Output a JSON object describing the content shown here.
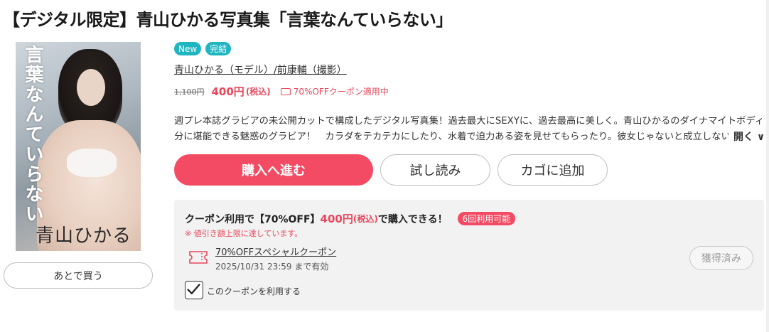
{
  "product": {
    "title": "【デジタル限定】青山ひかる写真集「言葉なんていらない」",
    "badges": [
      "New",
      "完結"
    ],
    "authors": "青山ひかる（モデル）/前康輔（撮影）",
    "cover": {
      "vertical_text": "言葉なんていらない",
      "name_text": "青山ひかる"
    }
  },
  "price": {
    "original": "1,100円",
    "current": "400円",
    "tax": "(税込)",
    "coupon_note": "70%OFFクーポン適用中"
  },
  "description": {
    "line1": "週プレ本誌グラビアの未公開カットで構成したデジタル写真集！過去最大にSEXYに、過去最高に美しく。青山ひかるのダイナマイトボディを存",
    "line2": "分に堪能できる魅惑のグラビア！　カラダをテカテカにしたり、水着で迫力ある姿を見せてもらったり。彼女じゃないと成立しない「王道",
    "open_label": "開く ∨"
  },
  "actions": {
    "buy": "購入へ進む",
    "trial": "試し読み",
    "cart": "カゴに追加",
    "later": "あとで買う"
  },
  "coupon": {
    "head_prefix": "クーポン利用で【70%OFF】",
    "head_price": "400円",
    "head_tax": "(税込)",
    "head_suffix": "で購入できる！",
    "uses": "6回利用可能",
    "warning": "※ 値引き額上限に達しています。",
    "name": "70%OFFスペシャルクーポン",
    "valid": "2025/10/31 23:59 まで有効",
    "acquired": "獲得済み",
    "checkbox_label": "このクーポンを利用する",
    "checked": true
  },
  "colors": {
    "accent": "#f24b63",
    "price": "#e8485c",
    "badge": "#1fb6c1"
  }
}
